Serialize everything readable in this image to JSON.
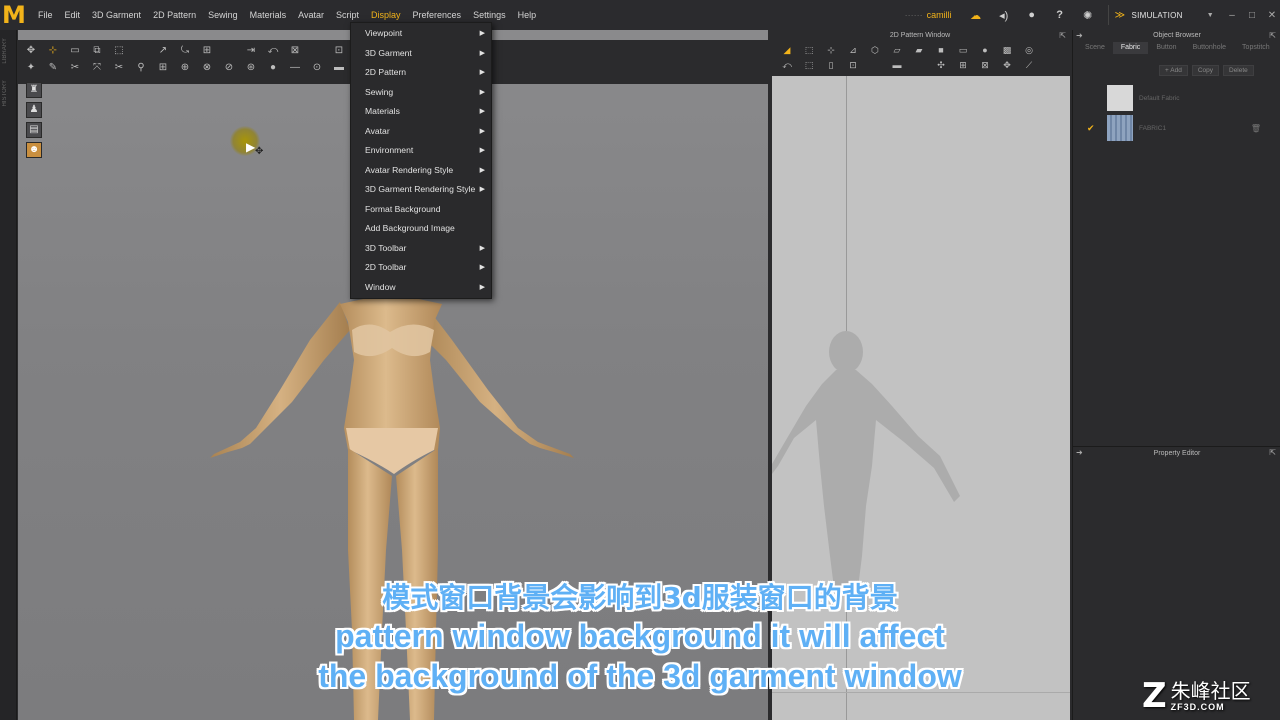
{
  "app": {
    "logo_letter": "M"
  },
  "menubar": {
    "items": [
      "File",
      "Edit",
      "3D Garment",
      "2D Pattern",
      "Sewing",
      "Materials",
      "Avatar",
      "Script",
      "Display",
      "Preferences",
      "Settings",
      "Help"
    ],
    "active": "Display"
  },
  "status": {
    "user_prefix": "······",
    "user": "camilli",
    "mode": "SIMULATION",
    "accent_color": "#f2b31a"
  },
  "display_menu": {
    "items": [
      {
        "label": "Viewpoint",
        "submenu": true
      },
      {
        "label": "3D Garment",
        "submenu": true
      },
      {
        "label": "2D Pattern",
        "submenu": true
      },
      {
        "label": "Sewing",
        "submenu": true
      },
      {
        "label": "Materials",
        "submenu": true
      },
      {
        "label": "Avatar",
        "submenu": true
      },
      {
        "label": "Environment",
        "submenu": true
      },
      {
        "label": "Avatar Rendering Style",
        "submenu": true
      },
      {
        "label": "3D Garment Rendering Style",
        "submenu": true
      },
      {
        "label": "Format Background",
        "submenu": false
      },
      {
        "label": "Add Background Image",
        "submenu": false
      },
      {
        "label": "3D Toolbar",
        "submenu": true
      },
      {
        "label": "2D Toolbar",
        "submenu": true
      },
      {
        "label": "Window",
        "submenu": true
      }
    ]
  },
  "side_tabs": [
    "LIBRARY",
    "HISTORY"
  ],
  "pattern_window": {
    "title": "2D Pattern Window"
  },
  "object_browser": {
    "title": "Object Browser",
    "tabs": [
      "Scene",
      "Fabric",
      "Button",
      "Buttonhole",
      "Topstitch"
    ],
    "active_tab": "Fabric",
    "actions": [
      "+ Add",
      "Copy",
      "Delete"
    ],
    "fabrics": [
      {
        "name": "Default Fabric",
        "checked": false,
        "color": "#d8d8d8"
      },
      {
        "name": "FABRIC1",
        "checked": true,
        "color": "#8ea3bf"
      }
    ]
  },
  "property_editor": {
    "title": "Property Editor"
  },
  "subtitles": {
    "zh": "模式窗口背景会影响到3d服装窗口的背景",
    "en_line1": "pattern window background it will affect",
    "en_line2": "the background of the 3d garment window"
  },
  "watermark": {
    "mark": "Z",
    "name": "朱峰社区",
    "url": "ZF3D.COM"
  }
}
